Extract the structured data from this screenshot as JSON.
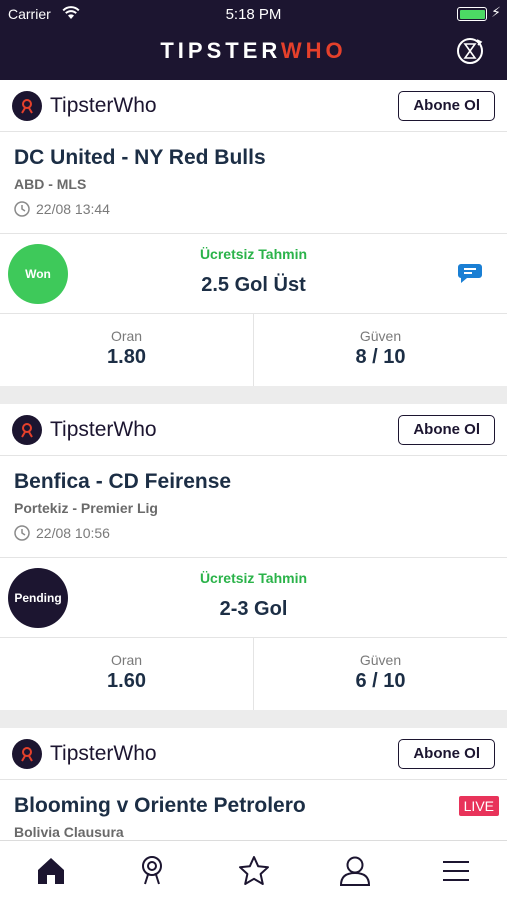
{
  "status_bar": {
    "carrier": "Carrier",
    "time": "5:18 PM"
  },
  "header": {
    "logo_main": "TIPSTER",
    "logo_accent": "WHO"
  },
  "cards": [
    {
      "tipster": "TipsterWho",
      "subscribe": "Abone Ol",
      "match": "DC United - NY Red Bulls",
      "league": "ABD - MLS",
      "date": "22/08 13:44",
      "result": "Won",
      "result_color": "#3ec95a",
      "pred_label": "Ücretsiz Tahmin",
      "prediction": "2.5 Gol Üst",
      "odds_label": "Oran",
      "odds": "1.80",
      "conf_label": "Güven",
      "confidence": "8 / 10"
    },
    {
      "tipster": "TipsterWho",
      "subscribe": "Abone Ol",
      "match": "Benfica - CD Feirense",
      "league": "Portekiz - Premier Lig",
      "date": "22/08 10:56",
      "result": "Pending",
      "result_color": "#1c1530",
      "pred_label": "Ücretsiz Tahmin",
      "prediction": "2-3 Gol",
      "odds_label": "Oran",
      "odds": "1.60",
      "conf_label": "Güven",
      "confidence": "6 / 10"
    },
    {
      "tipster": "TipsterWho",
      "subscribe": "Abone Ol",
      "match": "Blooming v Oriente Petrolero",
      "league": "Bolivia Clausura",
      "live": "LIVE"
    }
  ],
  "tabs": [
    "home-icon",
    "tipster-search-icon",
    "star-icon",
    "profile-icon",
    "menu-icon"
  ],
  "colors": {
    "header_bg": "#1c1530",
    "accent_red": "#e5402b",
    "green": "#2bb34a"
  }
}
